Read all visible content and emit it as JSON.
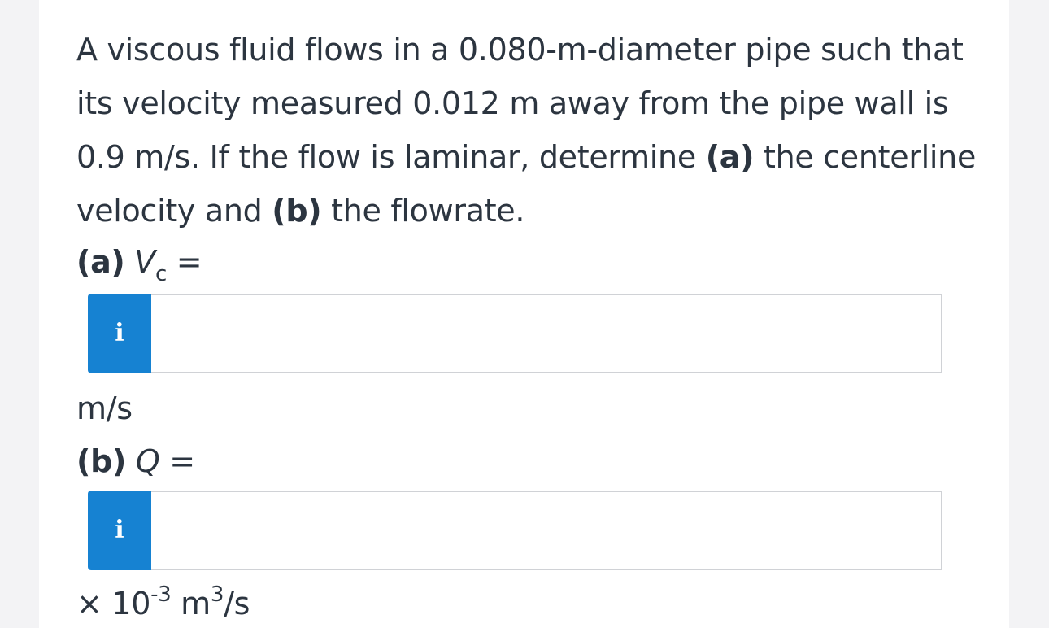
{
  "question": {
    "text_1": "A viscous fluid flows in a 0.080-m-diameter pipe such that its velocity measured 0.012 m away from the pipe wall is 0.9 m/s. If the flow is laminar, determine ",
    "part_a_marker": "(a)",
    "text_2": " the centerline velocity and ",
    "part_b_marker": "(b)",
    "text_3": " the flowrate."
  },
  "part_a": {
    "marker": "(a)",
    "variable": "V",
    "subscript": "c",
    "equals": "=",
    "info_label": "i",
    "input_value": "",
    "unit": "m/s"
  },
  "part_b": {
    "marker": "(b)",
    "variable": "Q",
    "equals": "=",
    "info_label": "i",
    "input_value": "",
    "unit_prefix": "× 10",
    "unit_exponent": "-3",
    "unit_base": " m",
    "unit_base_exponent": "3",
    "unit_suffix": "/s"
  },
  "colors": {
    "info_button_bg": "#1682d2",
    "text": "#2c3540",
    "input_border": "#d0d2d6",
    "page_bg": "#f3f3f5"
  },
  "icons": {
    "info": "info-icon"
  }
}
